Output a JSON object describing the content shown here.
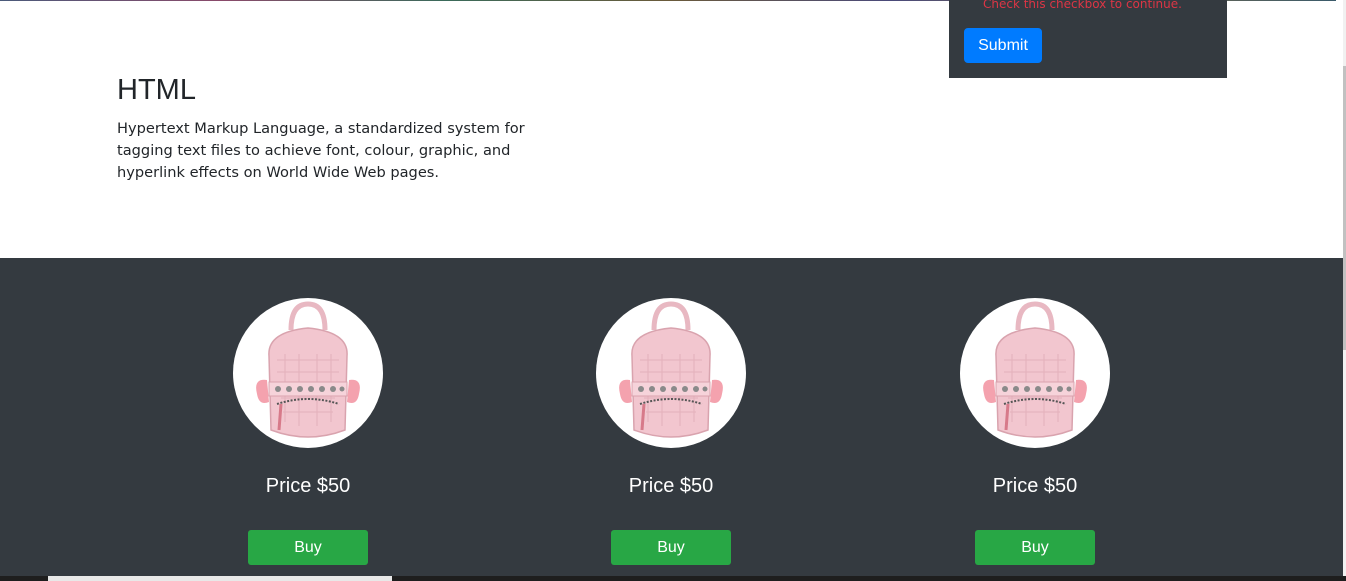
{
  "form": {
    "invalid_feedback": "Check this checkbox to continue.",
    "submit_label": "Submit"
  },
  "intro": {
    "title": "HTML",
    "text": "Hypertext Markup Language, a standardized system for tagging text files to achieve font, colour, graphic, and hyperlink effects on World Wide Web pages."
  },
  "products": [
    {
      "price": "Price $50",
      "buy_label": "Buy"
    },
    {
      "price": "Price $50",
      "buy_label": "Buy"
    },
    {
      "price": "Price $50",
      "buy_label": "Buy"
    }
  ],
  "colors": {
    "dark_section": "#343a40",
    "primary": "#007bff",
    "success": "#28a745",
    "danger": "#dc3545"
  }
}
